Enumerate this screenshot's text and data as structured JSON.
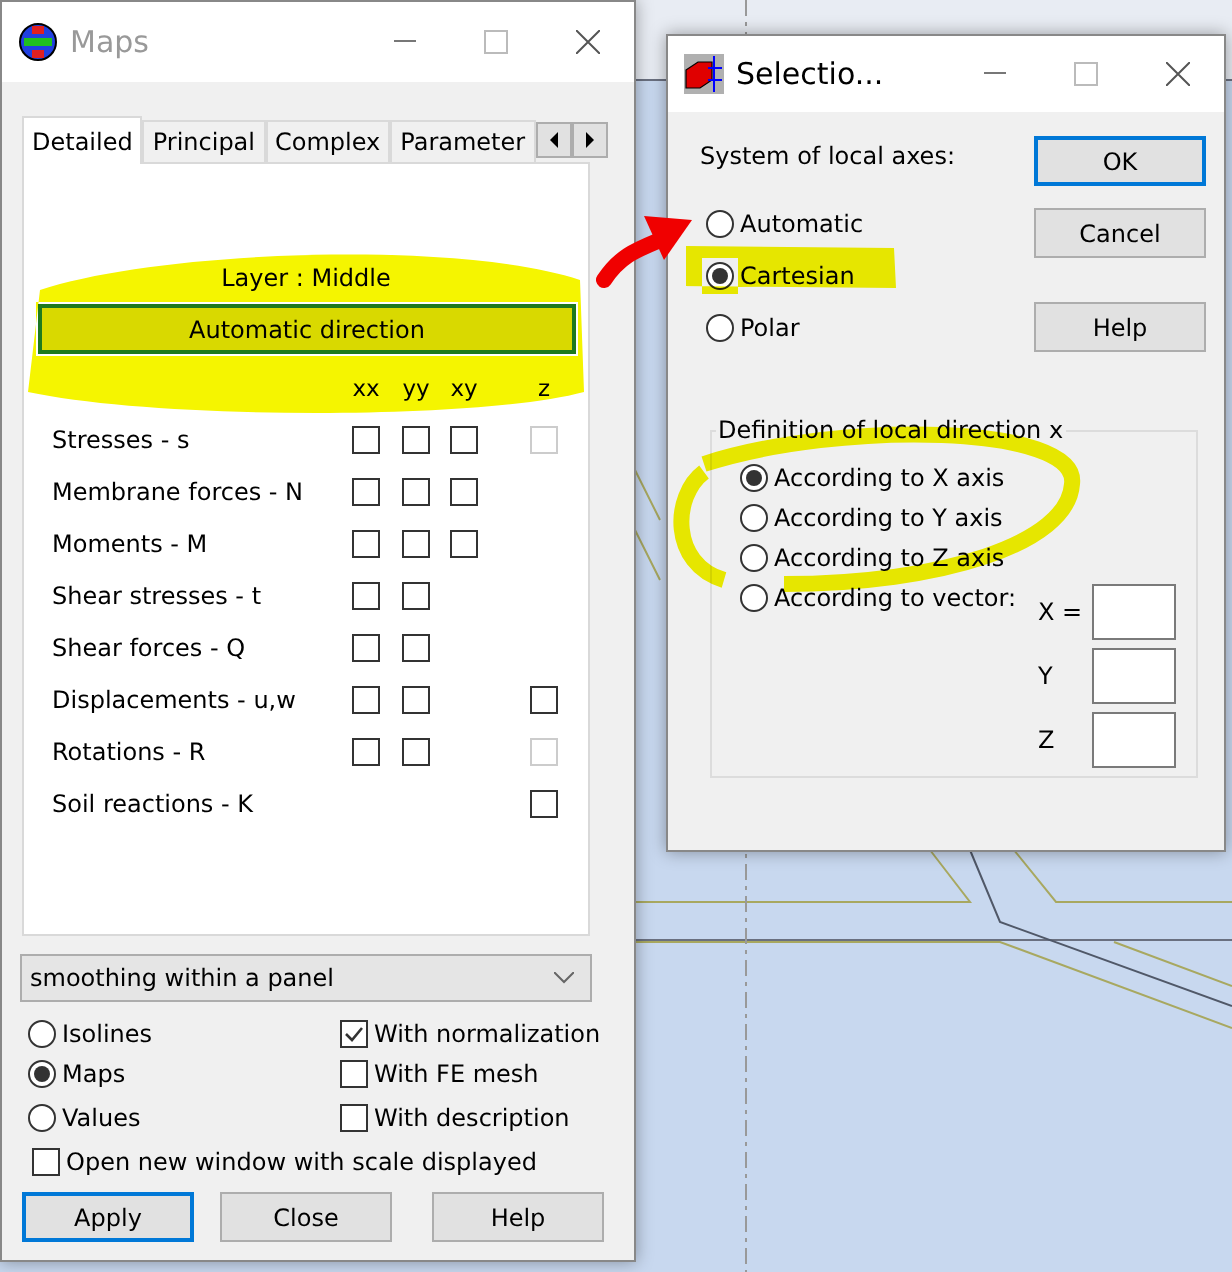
{
  "maps_window": {
    "title": "Maps",
    "tabs": [
      {
        "label": "Detailed",
        "selected": true
      },
      {
        "label": "Principal",
        "selected": false
      },
      {
        "label": "Complex",
        "selected": false
      },
      {
        "label": "Parameter",
        "selected": false
      }
    ],
    "layer_label": "Layer : Middle",
    "direction_button": "Automatic direction",
    "columns": [
      "xx",
      "yy",
      "xy",
      "z"
    ],
    "rows": [
      {
        "label": "Stresses - s",
        "xx": {
          "checked": false,
          "disabled": false
        },
        "yy": {
          "checked": false,
          "disabled": false
        },
        "xy": {
          "checked": false,
          "disabled": false
        },
        "z": {
          "checked": false,
          "disabled": true
        }
      },
      {
        "label": "Membrane forces - N",
        "xx": {
          "checked": false,
          "disabled": false
        },
        "yy": {
          "checked": false,
          "disabled": false
        },
        "xy": {
          "checked": false,
          "disabled": false
        }
      },
      {
        "label": "Moments - M",
        "xx": {
          "checked": false,
          "disabled": false
        },
        "yy": {
          "checked": false,
          "disabled": false
        },
        "xy": {
          "checked": false,
          "disabled": false
        }
      },
      {
        "label": "Shear stresses - t",
        "xx": {
          "checked": false,
          "disabled": false
        },
        "yy": {
          "checked": false,
          "disabled": false
        }
      },
      {
        "label": "Shear forces - Q",
        "xx": {
          "checked": false,
          "disabled": false
        },
        "yy": {
          "checked": false,
          "disabled": false
        }
      },
      {
        "label": "Displacements - u,w",
        "xx": {
          "checked": false,
          "disabled": false
        },
        "yy": {
          "checked": false,
          "disabled": false
        },
        "z": {
          "checked": false,
          "disabled": false
        }
      },
      {
        "label": "Rotations - R",
        "xx": {
          "checked": false,
          "disabled": false
        },
        "yy": {
          "checked": false,
          "disabled": false
        },
        "z": {
          "checked": false,
          "disabled": true
        }
      },
      {
        "label": "Soil reactions - K",
        "z": {
          "checked": false,
          "disabled": false
        }
      }
    ],
    "smoothing": "smoothing within a panel",
    "display_modes": [
      {
        "label": "Isolines",
        "selected": false
      },
      {
        "label": "Maps",
        "selected": true
      },
      {
        "label": "Values",
        "selected": false
      }
    ],
    "options": [
      {
        "label": "With normalization",
        "checked": true
      },
      {
        "label": "With FE mesh",
        "checked": false
      },
      {
        "label": "With description",
        "checked": false
      }
    ],
    "scale_window": {
      "label": "Open new window with scale displayed",
      "checked": false
    },
    "buttons": [
      {
        "label": "Apply",
        "default": true
      },
      {
        "label": "Close",
        "default": false
      },
      {
        "label": "Help",
        "default": false
      }
    ]
  },
  "selection_window": {
    "title": "Selectio...",
    "axes_label": "System of local axes:",
    "axes": [
      {
        "label": "Automatic",
        "selected": false
      },
      {
        "label": "Cartesian",
        "selected": true
      },
      {
        "label": "Polar",
        "selected": false
      }
    ],
    "buttons": [
      {
        "label": "OK",
        "default": true
      },
      {
        "label": "Cancel",
        "default": false
      },
      {
        "label": "Help",
        "default": false
      }
    ],
    "direction_group": {
      "title": "Definition of local direction x",
      "options": [
        {
          "label": "According to X axis",
          "selected": true
        },
        {
          "label": "According to Y axis",
          "selected": false
        },
        {
          "label": "According to Z axis",
          "selected": false
        },
        {
          "label": "According to vector:",
          "selected": false
        }
      ],
      "vector": [
        {
          "label": "X ="
        },
        {
          "label": "Y"
        },
        {
          "label": "Z"
        }
      ]
    }
  }
}
